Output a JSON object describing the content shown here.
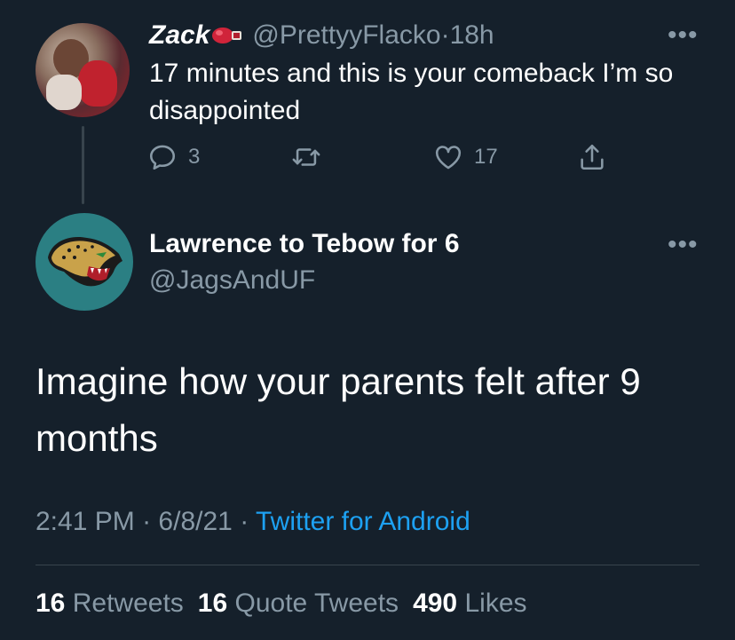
{
  "parent_tweet": {
    "name": "Zack",
    "handle": "@PrettyyFlacko",
    "separator": "·",
    "time": "18h",
    "text": "17 minutes and this is your comeback I’m so disappointed",
    "reply_count": "3",
    "retweet_count": "",
    "like_count": "17",
    "name_emoji_icon": "boxing-glove-icon",
    "more_icon": "more-options-icon"
  },
  "main_tweet": {
    "name": "Lawrence to Tebow for 6",
    "handle": "@JagsAndUF",
    "text": "Imagine how your parents felt after 9 months",
    "time": "2:41 PM",
    "date": "6/8/21",
    "separator": "·",
    "source": "Twitter for Android",
    "stats": {
      "retweets_count": "16",
      "retweets_label": "Retweets",
      "quotes_count": "16",
      "quotes_label": "Quote Tweets",
      "likes_count": "490",
      "likes_label": "Likes"
    }
  },
  "colors": {
    "background": "#15202b",
    "text_primary": "#ffffff",
    "text_secondary": "#8899a6",
    "link": "#1da1f2",
    "divider": "#38444d",
    "jaguars_teal": "#2b7f83"
  }
}
